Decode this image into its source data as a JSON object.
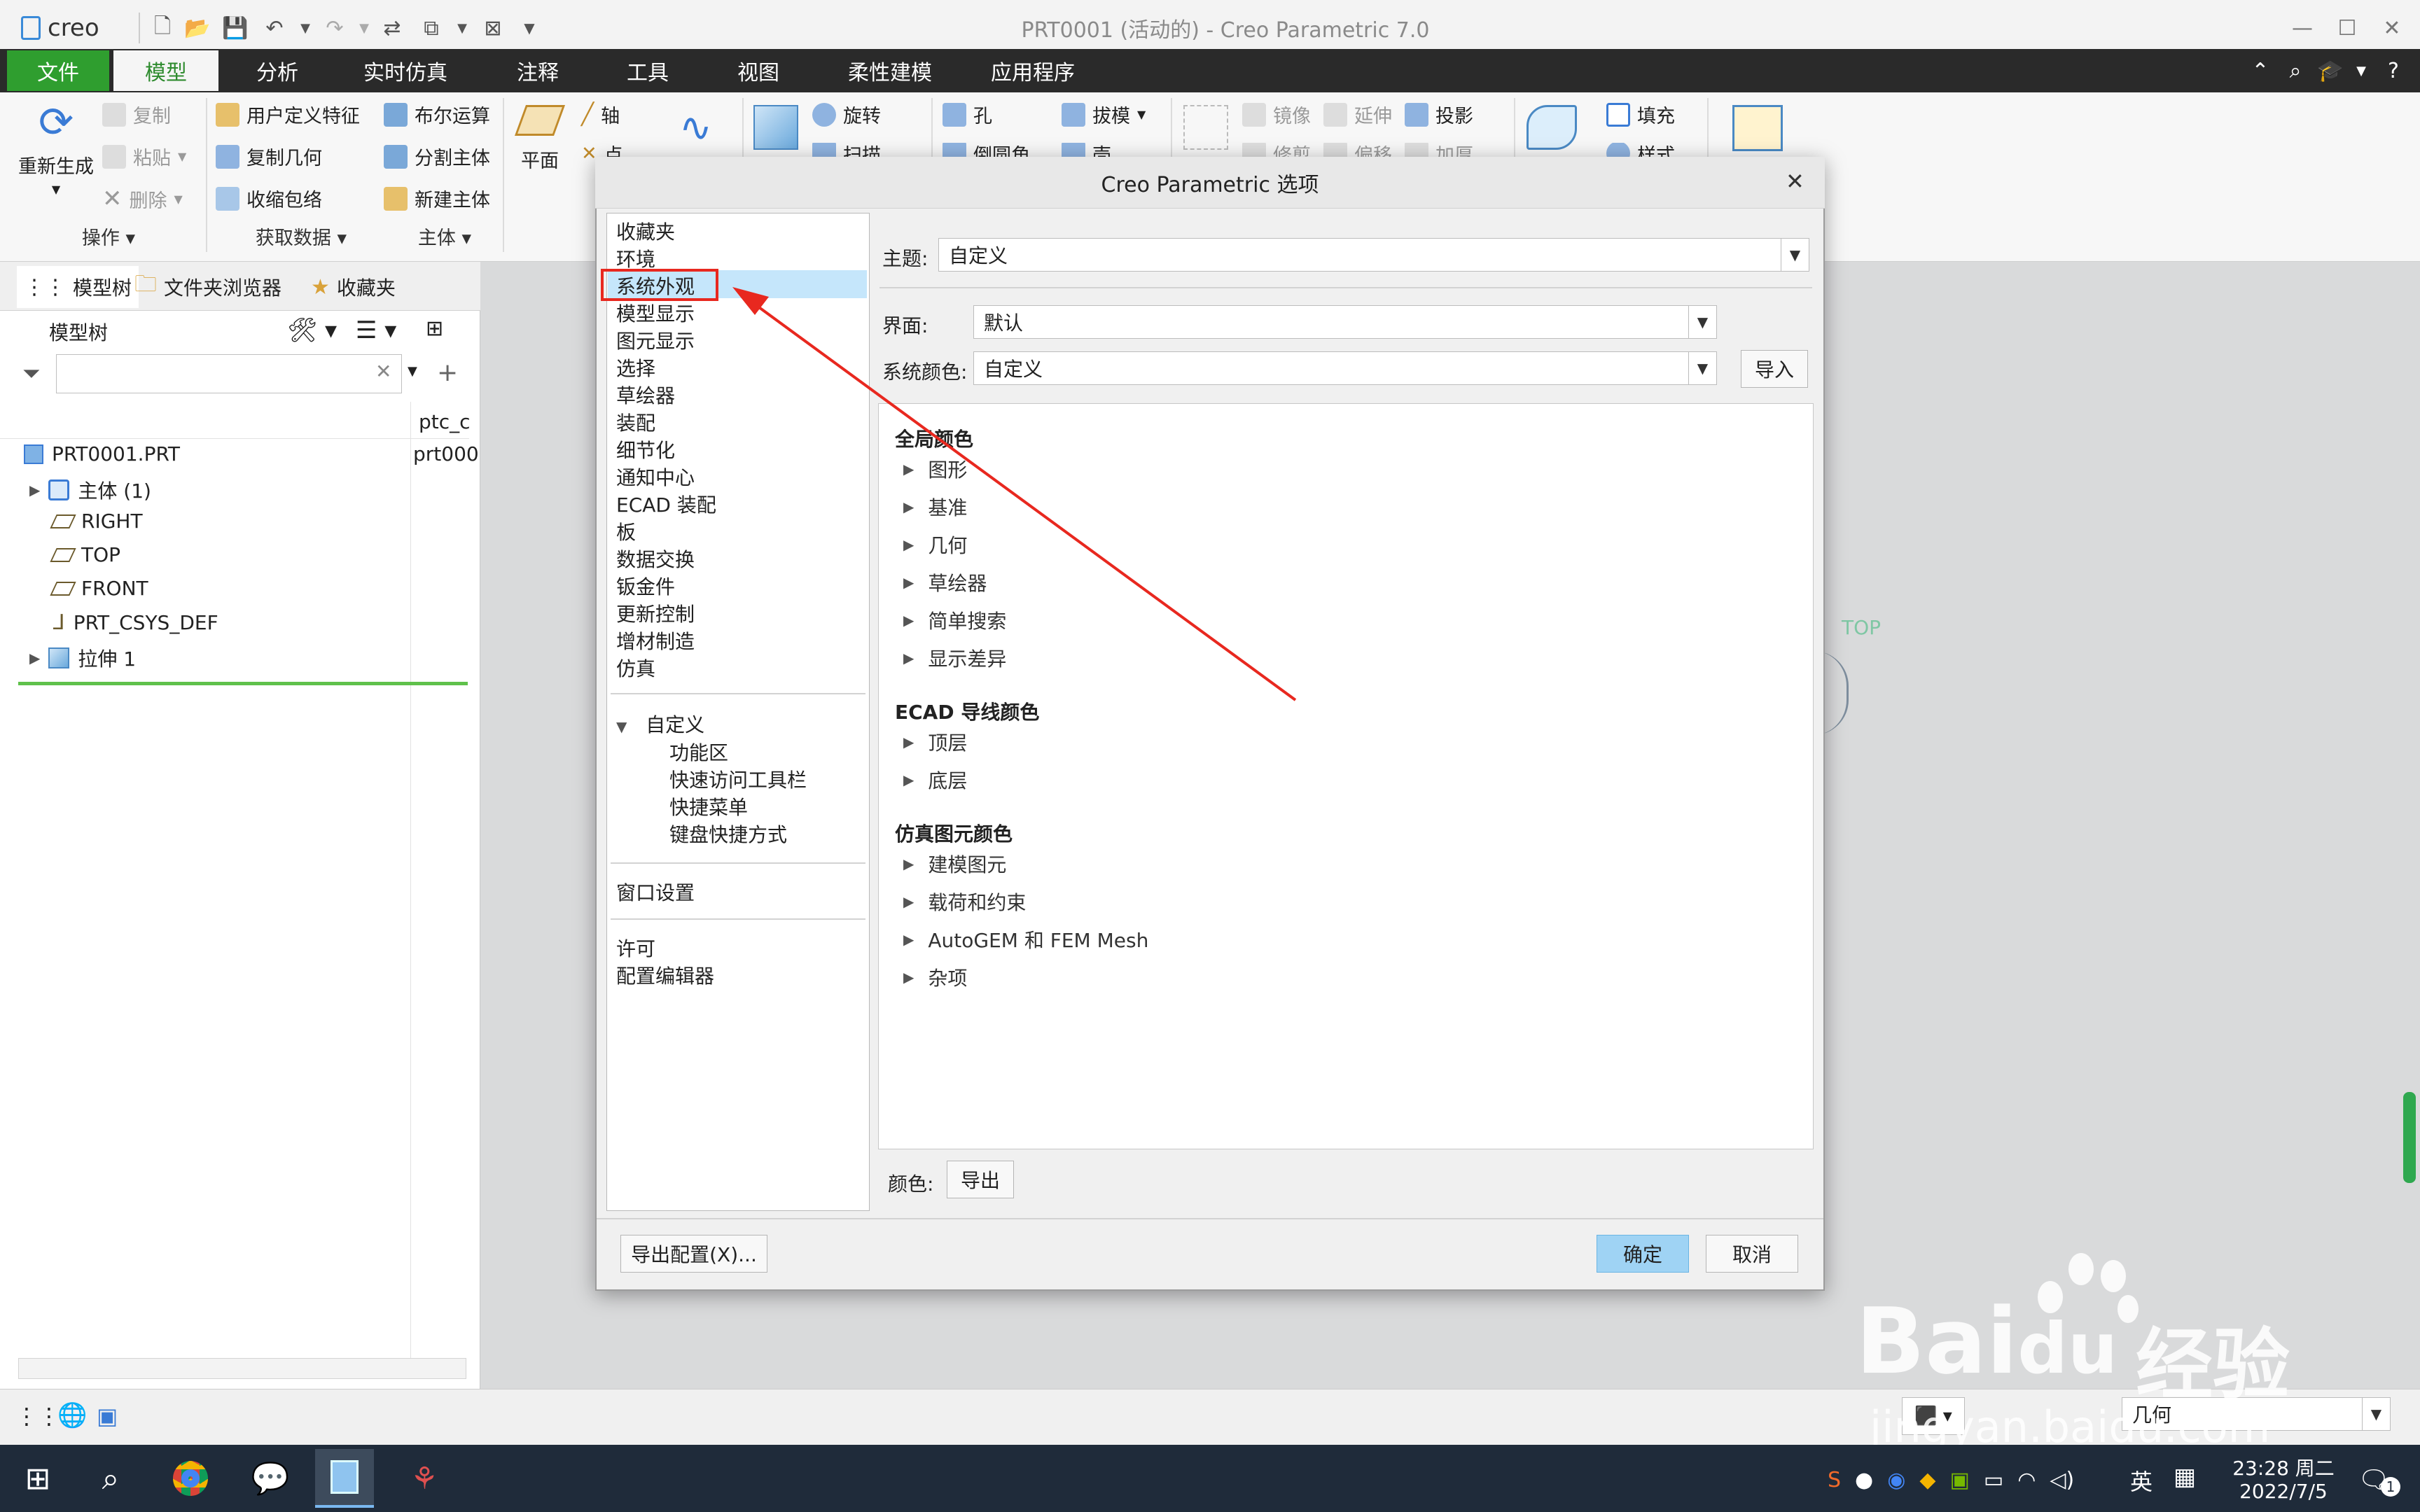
{
  "app": {
    "logo": "creo",
    "window_title": "PRT0001 (活动的) - Creo Parametric 7.0"
  },
  "menu": [
    "文件",
    "模型",
    "分析",
    "实时仿真",
    "注释",
    "工具",
    "视图",
    "柔性建模",
    "应用程序"
  ],
  "ribbon": {
    "regenerate": "重新生成",
    "copy": "复制",
    "paste": "粘贴",
    "delete": "删除",
    "udf": "用户定义特征",
    "copy_geom": "复制几何",
    "shrinkwrap": "收缩包络",
    "boolean": "布尔运算",
    "split_body": "分割主体",
    "new_body": "新建主体",
    "plane": "平面",
    "axis": "轴",
    "point": "点",
    "revolve": "旋转",
    "sweep": "扫描",
    "hole": "孔",
    "round": "倒圆角",
    "draft": "拔模",
    "shell": "壳",
    "mirror": "镜像",
    "extend": "延伸",
    "project": "投影",
    "trim": "修剪",
    "offset": "偏移",
    "thicken": "加厚",
    "fill": "填充",
    "style": "样式",
    "group_ops": "操作",
    "group_getdata": "获取数据",
    "group_body": "主体"
  },
  "left_panel": {
    "tabs": [
      "模型树",
      "文件夹浏览器",
      "收藏夹"
    ],
    "tree_title": "模型树",
    "column_header": "ptc_c",
    "column_value": "prt000",
    "items": [
      "PRT0001.PRT",
      "主体 (1)",
      "RIGHT",
      "TOP",
      "FRONT",
      "PRT_CSYS_DEF",
      "拉伸 1"
    ]
  },
  "graphics": {
    "datum_label": "TOP"
  },
  "dialog": {
    "title": "Creo Parametric 选项",
    "categories": [
      "收藏夹",
      "环境",
      "系统外观",
      "模型显示",
      "图元显示",
      "选择",
      "草绘器",
      "装配",
      "细节化",
      "通知中心",
      "ECAD 装配",
      "板",
      "数据交换",
      "钣金件",
      "更新控制",
      "增材制造",
      "仿真"
    ],
    "customize": {
      "label": "自定义",
      "children": [
        "功能区",
        "快速访问工具栏",
        "快捷菜单",
        "键盘快捷方式"
      ]
    },
    "window_settings": "窗口设置",
    "license": "许可",
    "config_editor": "配置编辑器",
    "theme_label": "主题:",
    "theme_value": "自定义",
    "interface_label": "界面:",
    "interface_value": "默认",
    "syscolor_label": "系统颜色:",
    "syscolor_value": "自定义",
    "import_button": "导入",
    "sections": [
      {
        "title": "全局颜色",
        "items": [
          "图形",
          "基准",
          "几何",
          "草绘器",
          "简单搜索",
          "显示差异"
        ]
      },
      {
        "title": "ECAD 导线颜色",
        "items": [
          "顶层",
          "底层"
        ]
      },
      {
        "title": "仿真图元颜色",
        "items": [
          "建模图元",
          "载荷和约束",
          "AutoGEM 和 FEM Mesh",
          "杂项"
        ]
      }
    ],
    "color_label": "颜色:",
    "export_button": "导出",
    "export_config_button": "导出配置(X)...",
    "ok_button": "确定",
    "cancel_button": "取消"
  },
  "status_bar": {
    "filter_value": "几何"
  },
  "taskbar": {
    "ime": "英",
    "time": "23:28 周二",
    "date": "2022/7/5",
    "notify_count": "1"
  },
  "watermark": {
    "brand": "Bai",
    "brand2": "du",
    "tag": "经验",
    "url": "jingyan.baidu.com"
  },
  "colors": {
    "file_menu": "#2f9e2f",
    "selection": "#c5e6fb",
    "annotation": "#e8281f"
  }
}
